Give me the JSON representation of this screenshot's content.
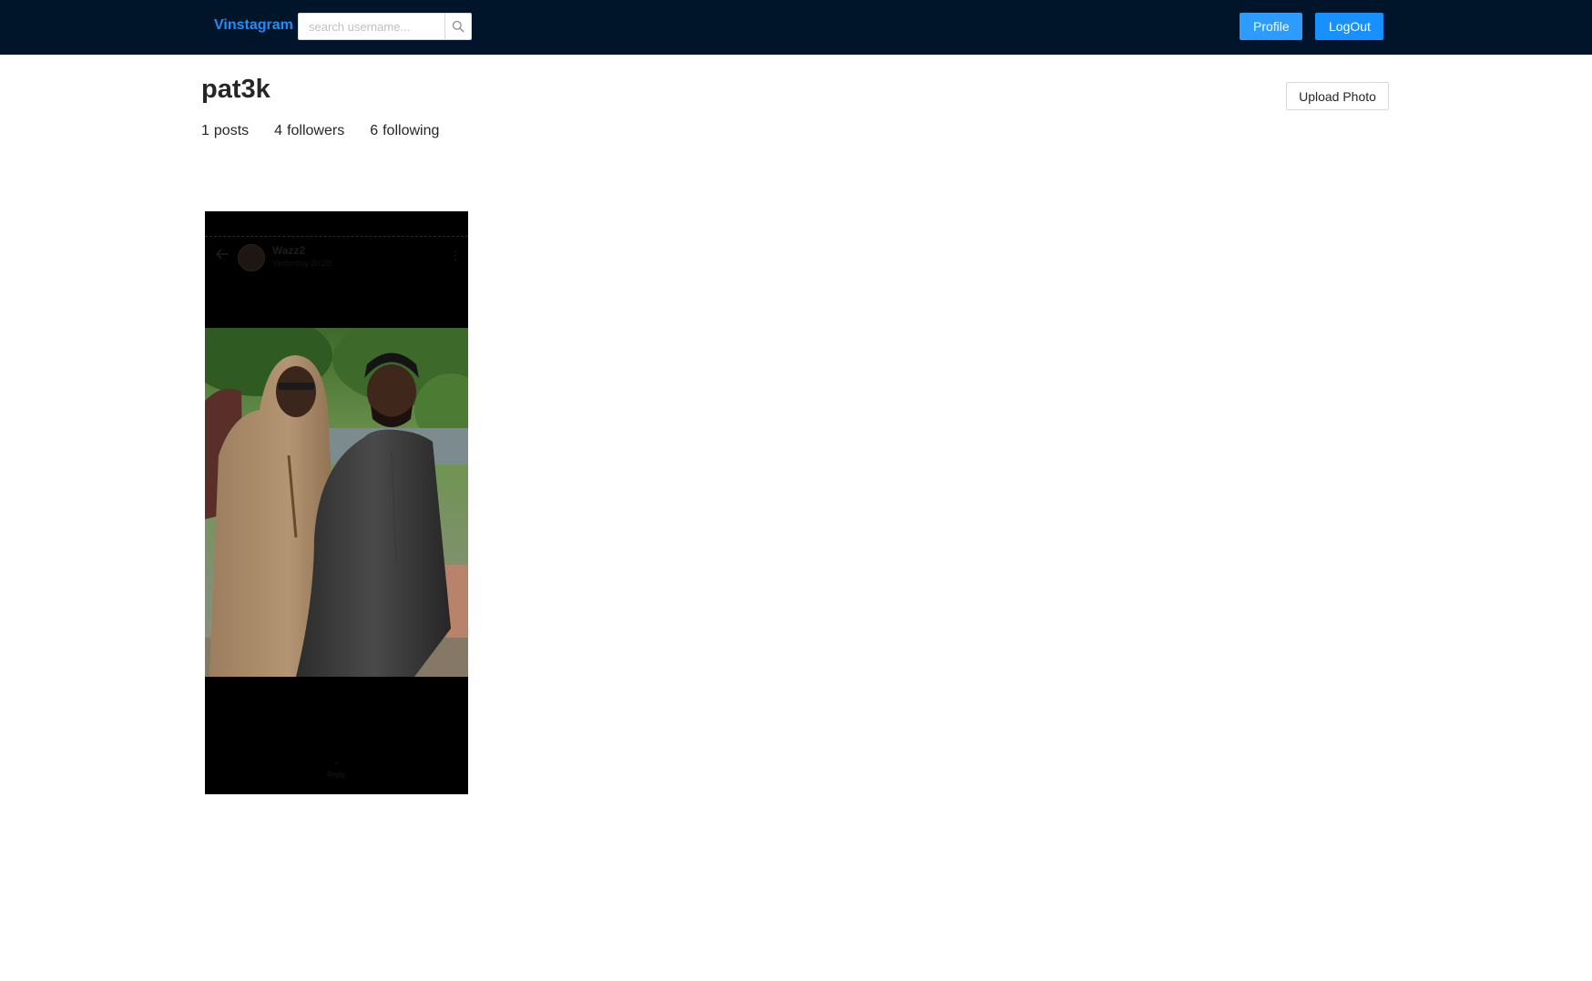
{
  "header": {
    "brand": "Vinstagram",
    "search_placeholder": "search username...",
    "profile_label": "Profile",
    "logout_label": "LogOut"
  },
  "profile": {
    "username": "pat3k",
    "upload_label": "Upload Photo",
    "stats": [
      {
        "count": "1",
        "label": "posts"
      },
      {
        "count": "4",
        "label": "followers"
      },
      {
        "count": "6",
        "label": "following"
      }
    ]
  },
  "posts": [
    {
      "embedded_name": "Wazz2",
      "embedded_time": "Yesterday 20:28",
      "embedded_reply": "Reply"
    }
  ],
  "colors": {
    "header_bg": "#001529",
    "accent": "#1890ff"
  },
  "icons": [
    "search-icon",
    "back-arrow-icon",
    "more-dots-icon",
    "chevron-up-icon"
  ]
}
